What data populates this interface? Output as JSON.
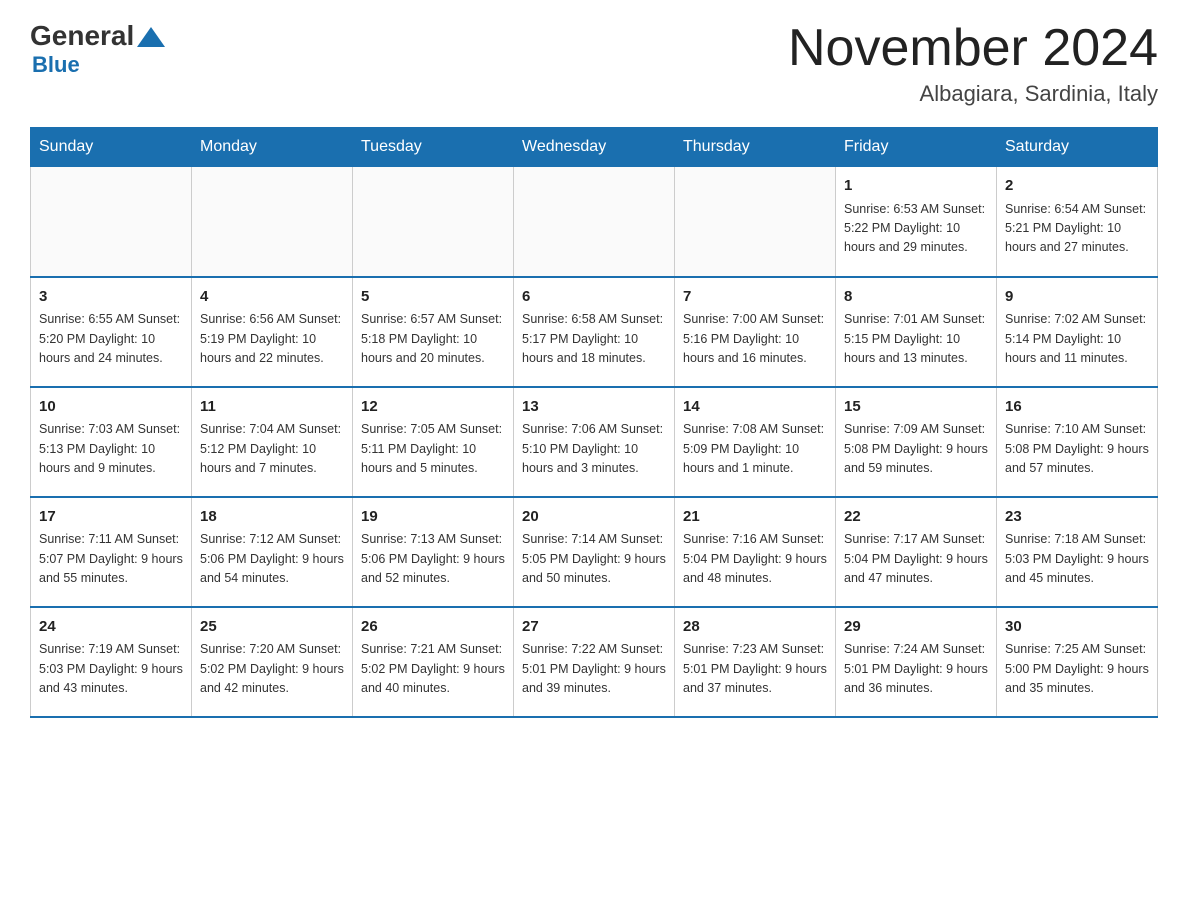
{
  "header": {
    "logo_general": "General",
    "logo_blue": "Blue",
    "title": "November 2024",
    "subtitle": "Albagiara, Sardinia, Italy"
  },
  "weekdays": [
    "Sunday",
    "Monday",
    "Tuesday",
    "Wednesday",
    "Thursday",
    "Friday",
    "Saturday"
  ],
  "weeks": [
    [
      {
        "day": "",
        "info": ""
      },
      {
        "day": "",
        "info": ""
      },
      {
        "day": "",
        "info": ""
      },
      {
        "day": "",
        "info": ""
      },
      {
        "day": "",
        "info": ""
      },
      {
        "day": "1",
        "info": "Sunrise: 6:53 AM\nSunset: 5:22 PM\nDaylight: 10 hours\nand 29 minutes."
      },
      {
        "day": "2",
        "info": "Sunrise: 6:54 AM\nSunset: 5:21 PM\nDaylight: 10 hours\nand 27 minutes."
      }
    ],
    [
      {
        "day": "3",
        "info": "Sunrise: 6:55 AM\nSunset: 5:20 PM\nDaylight: 10 hours\nand 24 minutes."
      },
      {
        "day": "4",
        "info": "Sunrise: 6:56 AM\nSunset: 5:19 PM\nDaylight: 10 hours\nand 22 minutes."
      },
      {
        "day": "5",
        "info": "Sunrise: 6:57 AM\nSunset: 5:18 PM\nDaylight: 10 hours\nand 20 minutes."
      },
      {
        "day": "6",
        "info": "Sunrise: 6:58 AM\nSunset: 5:17 PM\nDaylight: 10 hours\nand 18 minutes."
      },
      {
        "day": "7",
        "info": "Sunrise: 7:00 AM\nSunset: 5:16 PM\nDaylight: 10 hours\nand 16 minutes."
      },
      {
        "day": "8",
        "info": "Sunrise: 7:01 AM\nSunset: 5:15 PM\nDaylight: 10 hours\nand 13 minutes."
      },
      {
        "day": "9",
        "info": "Sunrise: 7:02 AM\nSunset: 5:14 PM\nDaylight: 10 hours\nand 11 minutes."
      }
    ],
    [
      {
        "day": "10",
        "info": "Sunrise: 7:03 AM\nSunset: 5:13 PM\nDaylight: 10 hours\nand 9 minutes."
      },
      {
        "day": "11",
        "info": "Sunrise: 7:04 AM\nSunset: 5:12 PM\nDaylight: 10 hours\nand 7 minutes."
      },
      {
        "day": "12",
        "info": "Sunrise: 7:05 AM\nSunset: 5:11 PM\nDaylight: 10 hours\nand 5 minutes."
      },
      {
        "day": "13",
        "info": "Sunrise: 7:06 AM\nSunset: 5:10 PM\nDaylight: 10 hours\nand 3 minutes."
      },
      {
        "day": "14",
        "info": "Sunrise: 7:08 AM\nSunset: 5:09 PM\nDaylight: 10 hours\nand 1 minute."
      },
      {
        "day": "15",
        "info": "Sunrise: 7:09 AM\nSunset: 5:08 PM\nDaylight: 9 hours\nand 59 minutes."
      },
      {
        "day": "16",
        "info": "Sunrise: 7:10 AM\nSunset: 5:08 PM\nDaylight: 9 hours\nand 57 minutes."
      }
    ],
    [
      {
        "day": "17",
        "info": "Sunrise: 7:11 AM\nSunset: 5:07 PM\nDaylight: 9 hours\nand 55 minutes."
      },
      {
        "day": "18",
        "info": "Sunrise: 7:12 AM\nSunset: 5:06 PM\nDaylight: 9 hours\nand 54 minutes."
      },
      {
        "day": "19",
        "info": "Sunrise: 7:13 AM\nSunset: 5:06 PM\nDaylight: 9 hours\nand 52 minutes."
      },
      {
        "day": "20",
        "info": "Sunrise: 7:14 AM\nSunset: 5:05 PM\nDaylight: 9 hours\nand 50 minutes."
      },
      {
        "day": "21",
        "info": "Sunrise: 7:16 AM\nSunset: 5:04 PM\nDaylight: 9 hours\nand 48 minutes."
      },
      {
        "day": "22",
        "info": "Sunrise: 7:17 AM\nSunset: 5:04 PM\nDaylight: 9 hours\nand 47 minutes."
      },
      {
        "day": "23",
        "info": "Sunrise: 7:18 AM\nSunset: 5:03 PM\nDaylight: 9 hours\nand 45 minutes."
      }
    ],
    [
      {
        "day": "24",
        "info": "Sunrise: 7:19 AM\nSunset: 5:03 PM\nDaylight: 9 hours\nand 43 minutes."
      },
      {
        "day": "25",
        "info": "Sunrise: 7:20 AM\nSunset: 5:02 PM\nDaylight: 9 hours\nand 42 minutes."
      },
      {
        "day": "26",
        "info": "Sunrise: 7:21 AM\nSunset: 5:02 PM\nDaylight: 9 hours\nand 40 minutes."
      },
      {
        "day": "27",
        "info": "Sunrise: 7:22 AM\nSunset: 5:01 PM\nDaylight: 9 hours\nand 39 minutes."
      },
      {
        "day": "28",
        "info": "Sunrise: 7:23 AM\nSunset: 5:01 PM\nDaylight: 9 hours\nand 37 minutes."
      },
      {
        "day": "29",
        "info": "Sunrise: 7:24 AM\nSunset: 5:01 PM\nDaylight: 9 hours\nand 36 minutes."
      },
      {
        "day": "30",
        "info": "Sunrise: 7:25 AM\nSunset: 5:00 PM\nDaylight: 9 hours\nand 35 minutes."
      }
    ]
  ]
}
